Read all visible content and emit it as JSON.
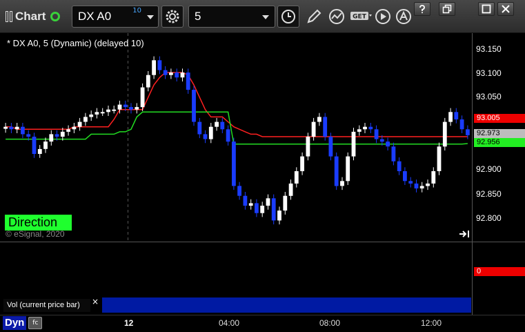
{
  "app": {
    "title": "Chart",
    "symbol": "DX A0",
    "symbol_superscript": "10",
    "interval": "5"
  },
  "toolbar": {
    "icons": [
      "settings-gear-icon",
      "clock-icon",
      "pencil-icon",
      "study-icon",
      "get-icon",
      "play-icon",
      "alert-icon"
    ],
    "get_label": "GET"
  },
  "window_buttons": [
    "question-icon",
    "restore-icon",
    "maximize-icon",
    "close-icon"
  ],
  "chart_header": "* DX A0, 5 (Dynamic) (delayed 10)",
  "direction_label": "Direction",
  "copyright": "© eSignal, 2020",
  "price_axis": {
    "labels": [
      "93.150",
      "93.100",
      "93.050",
      "93.005",
      "92.973",
      "92.956",
      "92.900",
      "92.850",
      "92.800"
    ]
  },
  "tags": {
    "red_ma": "93.005",
    "last_price": "92.973",
    "green_ma": "92.956",
    "volume": "0"
  },
  "volume_panel": {
    "label": "Vol (current price bar)",
    "close": "×"
  },
  "time_axis": {
    "tab": "Dyn",
    "tab_icon": "fc",
    "labels": [
      "12",
      "04:00",
      "08:00",
      "12:00"
    ]
  },
  "colors": {
    "background": "#000000",
    "bar_up": "#ffffff",
    "bar_down": "#1a3cff",
    "ma_fast": "#ff2020",
    "ma_slow": "#22dd22",
    "direction_badge": "#1fff2e",
    "volume_panel": "#001aa3"
  },
  "chart_data": {
    "type": "candlestick",
    "symbol": "DX A0",
    "interval": "5",
    "ylim": [
      92.76,
      93.18
    ],
    "x_ticks": [
      "12",
      "04:00",
      "08:00",
      "12:00"
    ],
    "y_ticks": [
      92.8,
      92.85,
      92.9,
      92.95,
      93.0,
      93.05,
      93.1,
      93.15
    ],
    "close": [
      92.99,
      92.985,
      92.99,
      92.975,
      92.97,
      92.935,
      92.945,
      92.96,
      92.975,
      92.97,
      92.98,
      92.985,
      92.99,
      93.0,
      93.01,
      93.015,
      93.02,
      93.02,
      93.025,
      93.025,
      93.035,
      93.03,
      93.025,
      93.03,
      93.07,
      93.095,
      93.125,
      93.105,
      93.095,
      93.1,
      93.09,
      93.1,
      93.065,
      93.0,
      92.975,
      92.965,
      92.99,
      93.0,
      92.985,
      92.96,
      92.87,
      92.85,
      92.83,
      92.835,
      92.815,
      92.83,
      92.845,
      92.8,
      92.82,
      92.85,
      92.875,
      92.9,
      92.93,
      92.97,
      93.0,
      93.01,
      92.97,
      92.93,
      92.87,
      92.88,
      92.93,
      92.98,
      92.985,
      92.99,
      92.985,
      92.965,
      92.96,
      92.95,
      92.92,
      92.9,
      92.88,
      92.875,
      92.865,
      92.87,
      92.875,
      92.9,
      92.95,
      93.0,
      93.02,
      93.005,
      92.985,
      92.973
    ],
    "ma_fast": [
      92.99,
      92.99,
      92.985,
      92.985,
      92.985,
      92.985,
      92.985,
      92.985,
      92.985,
      92.985,
      92.985,
      92.985,
      92.99,
      92.99,
      92.99,
      92.99,
      92.99,
      92.99,
      92.99,
      93.005,
      93.025,
      93.025,
      93.025,
      93.025,
      93.025,
      93.05,
      93.075,
      93.09,
      93.1,
      93.1,
      93.1,
      93.1,
      93.095,
      93.075,
      93.05,
      93.025,
      93.01,
      93.01,
      93.01,
      93.0,
      92.99,
      92.985,
      92.98,
      92.975,
      92.975,
      92.97,
      92.97,
      92.97,
      92.97,
      92.97,
      92.97,
      92.97,
      92.97,
      92.97,
      92.97,
      92.97,
      92.97,
      92.97,
      92.97,
      92.97,
      92.97,
      92.97,
      92.97,
      92.97,
      92.97,
      92.97,
      92.97,
      92.97,
      92.97,
      92.97,
      92.97,
      92.97,
      92.97,
      92.97,
      92.97,
      92.97,
      92.97,
      92.97,
      92.97,
      92.97,
      92.97,
      92.97
    ],
    "ma_slow": [
      92.965,
      92.965,
      92.965,
      92.965,
      92.965,
      92.965,
      92.965,
      92.965,
      92.965,
      92.965,
      92.965,
      92.965,
      92.965,
      92.965,
      92.965,
      92.975,
      92.975,
      92.975,
      92.975,
      92.975,
      92.98,
      92.98,
      92.985,
      93.01,
      93.02,
      93.02,
      93.02,
      93.02,
      93.02,
      93.02,
      93.02,
      93.02,
      93.02,
      93.02,
      93.02,
      93.02,
      93.02,
      93.02,
      93.02,
      93.02,
      92.955,
      92.955,
      92.955,
      92.955,
      92.955,
      92.955,
      92.955,
      92.955,
      92.955,
      92.955,
      92.955,
      92.955,
      92.955,
      92.955,
      92.955,
      92.955,
      92.955,
      92.955,
      92.955,
      92.955,
      92.955,
      92.955,
      92.955,
      92.955,
      92.955,
      92.955,
      92.955,
      92.955,
      92.955,
      92.955,
      92.955,
      92.955,
      92.955,
      92.955,
      92.955,
      92.955,
      92.955,
      92.955,
      92.955,
      92.955,
      92.955,
      92.956
    ],
    "last_price": 92.973
  }
}
